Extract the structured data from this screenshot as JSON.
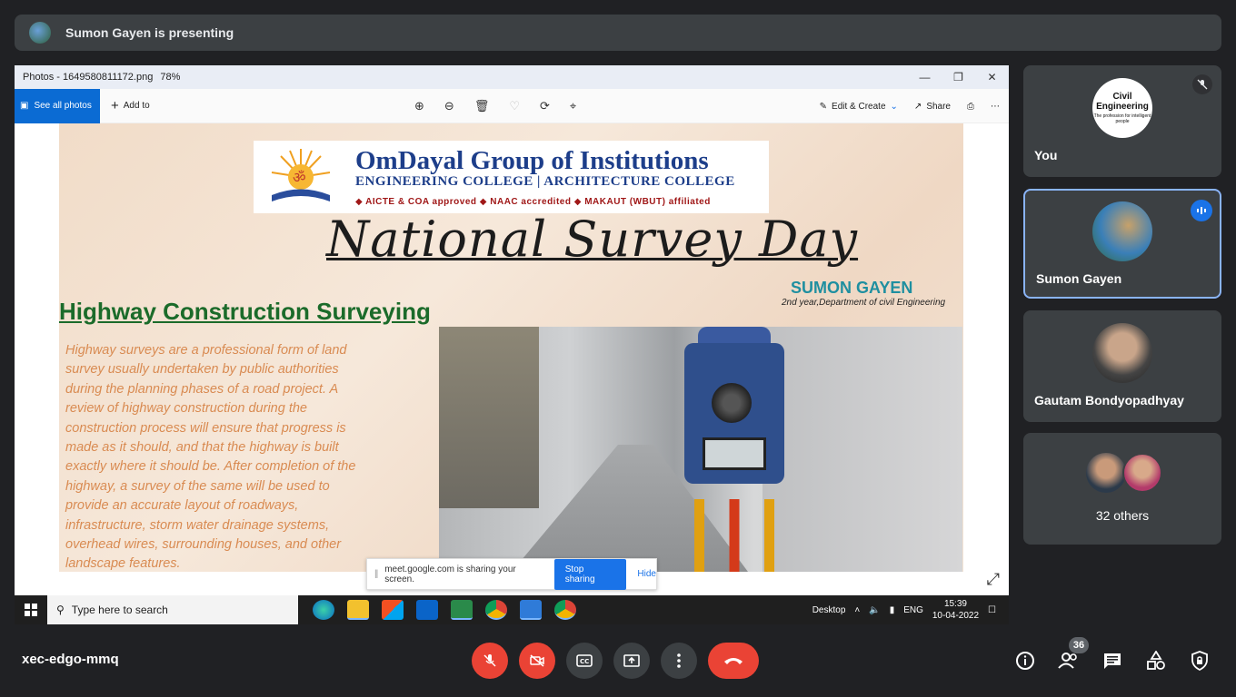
{
  "presenting": {
    "text": "Sumon Gayen is presenting"
  },
  "window": {
    "title": "Photos - 1649580811172.png",
    "zoom": "78%"
  },
  "photos_toolbar": {
    "see_all": "See all photos",
    "add_to": "Add to",
    "edit_create": "Edit & Create",
    "share": "Share"
  },
  "slide": {
    "logo_title": "OmDayal Group of Institutions",
    "logo_sub": "ENGINEERING COLLEGE | ARCHITECTURE COLLEGE",
    "logo_approved": "◆ AICTE & COA approved ◆ NAAC accredited ◆ MAKAUT (WBUT) affiliated",
    "script_title": "National Survey Day",
    "author": "SUMON GAYEN",
    "author_dept": "2nd year,Department of civil Engineering",
    "heading": "Highway Construction Surveying",
    "body": "Highway surveys are a professional form of land survey usually undertaken by public authorities during the planning phases of a road project. A review of highway construction during the construction process will ensure that progress is made as it should, and that the highway is built exactly where it should be. After completion of the highway, a survey of the same will be used to provide an accurate layout of roadways, infrastructure, storm water drainage systems, overhead wires, surrounding houses, and other landscape features."
  },
  "share_popup": {
    "text": "meet.google.com is sharing your screen.",
    "stop": "Stop sharing",
    "hide": "Hide"
  },
  "taskbar": {
    "search": "Type here to search",
    "desktop": "Desktop",
    "lang": "ENG",
    "time": "15:39",
    "date": "10-04-2022"
  },
  "participants": [
    {
      "name": "You",
      "avatar_text": "Civil Engineering",
      "avatar_sub": "The profession for intelligent people"
    },
    {
      "name": "Sumon Gayen"
    },
    {
      "name": "Gautam Bondyopadhyay"
    },
    {
      "name": "32 others"
    }
  ],
  "meeting": {
    "code": "xec-edgo-mmq",
    "people_count": "36"
  },
  "colors": {
    "accent": "#1a73e8",
    "danger": "#ea4335",
    "tile": "#3c4043",
    "bg": "#202124"
  }
}
